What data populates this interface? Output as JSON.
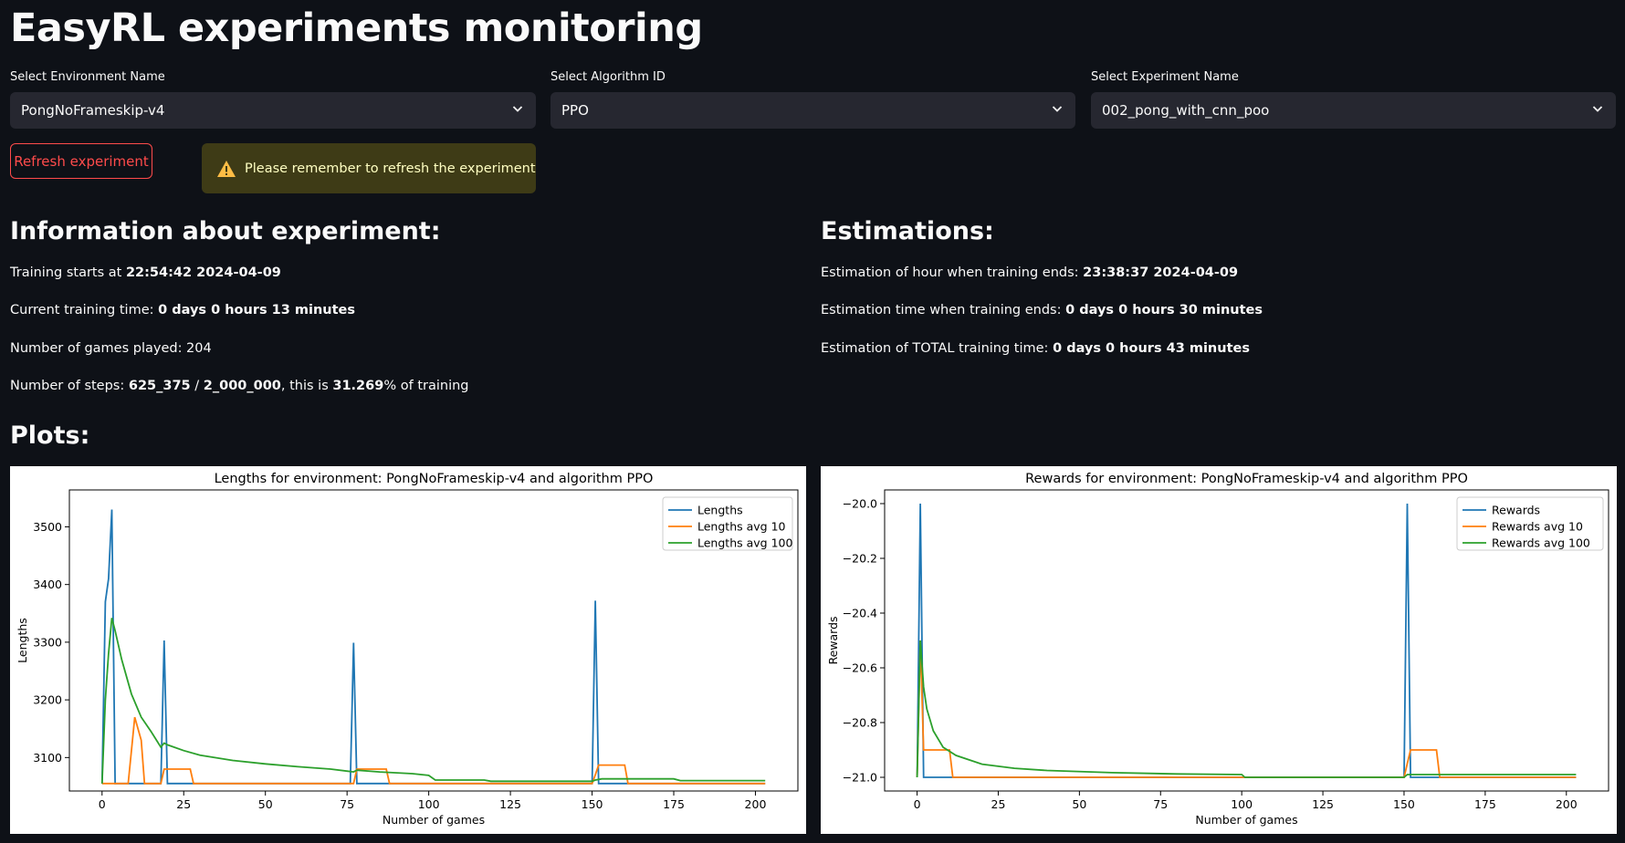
{
  "page": {
    "title": "EasyRL experiments monitoring"
  },
  "selectors": [
    {
      "label": "Select Environment Name",
      "value": "PongNoFrameskip-v4"
    },
    {
      "label": "Select Algorithm ID",
      "value": "PPO"
    },
    {
      "label": "Select Experiment Name",
      "value": "002_pong_with_cnn_poo"
    }
  ],
  "refresh_button": "Refresh experiment",
  "warning": {
    "text": "Please remember to refresh the experiment",
    "icon": "warning-triangle-icon",
    "color": "#ffbd45"
  },
  "info": {
    "heading": "Information about experiment:",
    "training_start_label": "Training starts at ",
    "training_start_value": "22:54:42 2024-04-09",
    "current_time_label": "Current training time: ",
    "current_time_value": "0 days 0 hours 13 minutes",
    "games_played": "Number of games played: 204",
    "steps_label": "Number of steps: ",
    "steps_value": "625_375",
    "steps_sep": " / ",
    "steps_total": "2_000_000",
    "steps_mid": ", this is ",
    "steps_percent": "31.269",
    "steps_suffix": "% of training"
  },
  "estimations": {
    "heading": "Estimations:",
    "end_hour_label": "Estimation of hour when training ends: ",
    "end_hour_value": "23:38:37 2024-04-09",
    "time_left_label": "Estimation time when training ends: ",
    "time_left_value": "0 days 0 hours 30 minutes",
    "total_label": "Estimation of TOTAL training time: ",
    "total_value": "0 days 0 hours 43 minutes"
  },
  "plots_heading": "Plots:",
  "colors": {
    "accent": "#ff4b4b",
    "bg": "#0e1117",
    "blue": "#1f77b4",
    "orange": "#ff7f0e",
    "green": "#2ca02c"
  },
  "chart_data": [
    {
      "type": "line",
      "title": "Lengths for environment: PongNoFrameskip-v4 and algorithm PPO",
      "xlabel": "Number of games",
      "ylabel": "Lengths",
      "xlim": [
        -10,
        213
      ],
      "ylim": [
        3042,
        3564
      ],
      "xticks": [
        0,
        25,
        50,
        75,
        100,
        125,
        150,
        175,
        200
      ],
      "yticks": [
        3100,
        3200,
        3300,
        3400,
        3500
      ],
      "legend": "top-right",
      "series": [
        {
          "name": "Lengths",
          "color": "#1f77b4",
          "x": [
            0,
            1,
            2,
            3,
            4,
            18,
            19,
            20,
            76,
            77,
            78,
            150,
            151,
            152,
            203
          ],
          "y": [
            3055,
            3370,
            3410,
            3530,
            3055,
            3055,
            3303,
            3055,
            3055,
            3299,
            3055,
            3055,
            3372,
            3055,
            3055
          ]
        },
        {
          "name": "Lengths avg 10",
          "color": "#ff7f0e",
          "x": [
            0,
            4,
            8,
            10,
            12,
            13,
            18,
            19,
            27,
            28,
            77,
            78,
            87,
            88,
            101,
            150,
            151,
            152,
            160,
            161,
            203
          ],
          "y": [
            3055,
            3055,
            3055,
            3170,
            3130,
            3055,
            3055,
            3080,
            3080,
            3055,
            3055,
            3080,
            3080,
            3055,
            3055,
            3055,
            3070,
            3087,
            3087,
            3055,
            3055
          ]
        },
        {
          "name": "Lengths avg 100",
          "color": "#2ca02c",
          "x": [
            0,
            1,
            2,
            3,
            4,
            6,
            9,
            12,
            15,
            18,
            19,
            20,
            25,
            30,
            40,
            50,
            60,
            70,
            77,
            78,
            85,
            95,
            100,
            102,
            110,
            117,
            119,
            150,
            151,
            153,
            175,
            177,
            203
          ],
          "y": [
            3055,
            3200,
            3280,
            3342,
            3320,
            3270,
            3210,
            3170,
            3145,
            3118,
            3125,
            3122,
            3112,
            3104,
            3095,
            3089,
            3084,
            3080,
            3075,
            3078,
            3075,
            3072,
            3069,
            3061,
            3061,
            3061,
            3059,
            3059,
            3061,
            3063,
            3063,
            3060,
            3060
          ]
        }
      ]
    },
    {
      "type": "line",
      "title": "Rewards for environment: PongNoFrameskip-v4 and algorithm PPO",
      "xlabel": "Number of games",
      "ylabel": "Rewards",
      "xlim": [
        -10,
        213
      ],
      "ylim": [
        -21.05,
        -19.95
      ],
      "xticks": [
        0,
        25,
        50,
        75,
        100,
        125,
        150,
        175,
        200
      ],
      "yticks": [
        -21.0,
        -20.8,
        -20.6,
        -20.4,
        -20.2,
        -20.0
      ],
      "legend": "top-right",
      "series": [
        {
          "name": "Rewards",
          "color": "#1f77b4",
          "x": [
            0,
            1,
            2,
            150,
            151,
            152,
            203
          ],
          "y": [
            -21,
            -20,
            -21,
            -21,
            -20,
            -21,
            -21
          ]
        },
        {
          "name": "Rewards avg 10",
          "color": "#ff7f0e",
          "x": [
            0,
            1,
            2,
            10,
            11,
            150,
            151,
            152,
            160,
            161,
            203
          ],
          "y": [
            -21,
            -20.5,
            -20.9,
            -20.9,
            -21,
            -21,
            -20.95,
            -20.9,
            -20.9,
            -21,
            -21
          ]
        },
        {
          "name": "Rewards avg 100",
          "color": "#2ca02c",
          "x": [
            0,
            1,
            2,
            3,
            5,
            8,
            12,
            20,
            30,
            40,
            60,
            80,
            100,
            101,
            150,
            151,
            203
          ],
          "y": [
            -21,
            -20.5,
            -20.67,
            -20.75,
            -20.83,
            -20.89,
            -20.92,
            -20.952,
            -20.967,
            -20.975,
            -20.983,
            -20.9875,
            -20.99,
            -21,
            -21,
            -20.99,
            -20.99
          ]
        }
      ]
    }
  ]
}
